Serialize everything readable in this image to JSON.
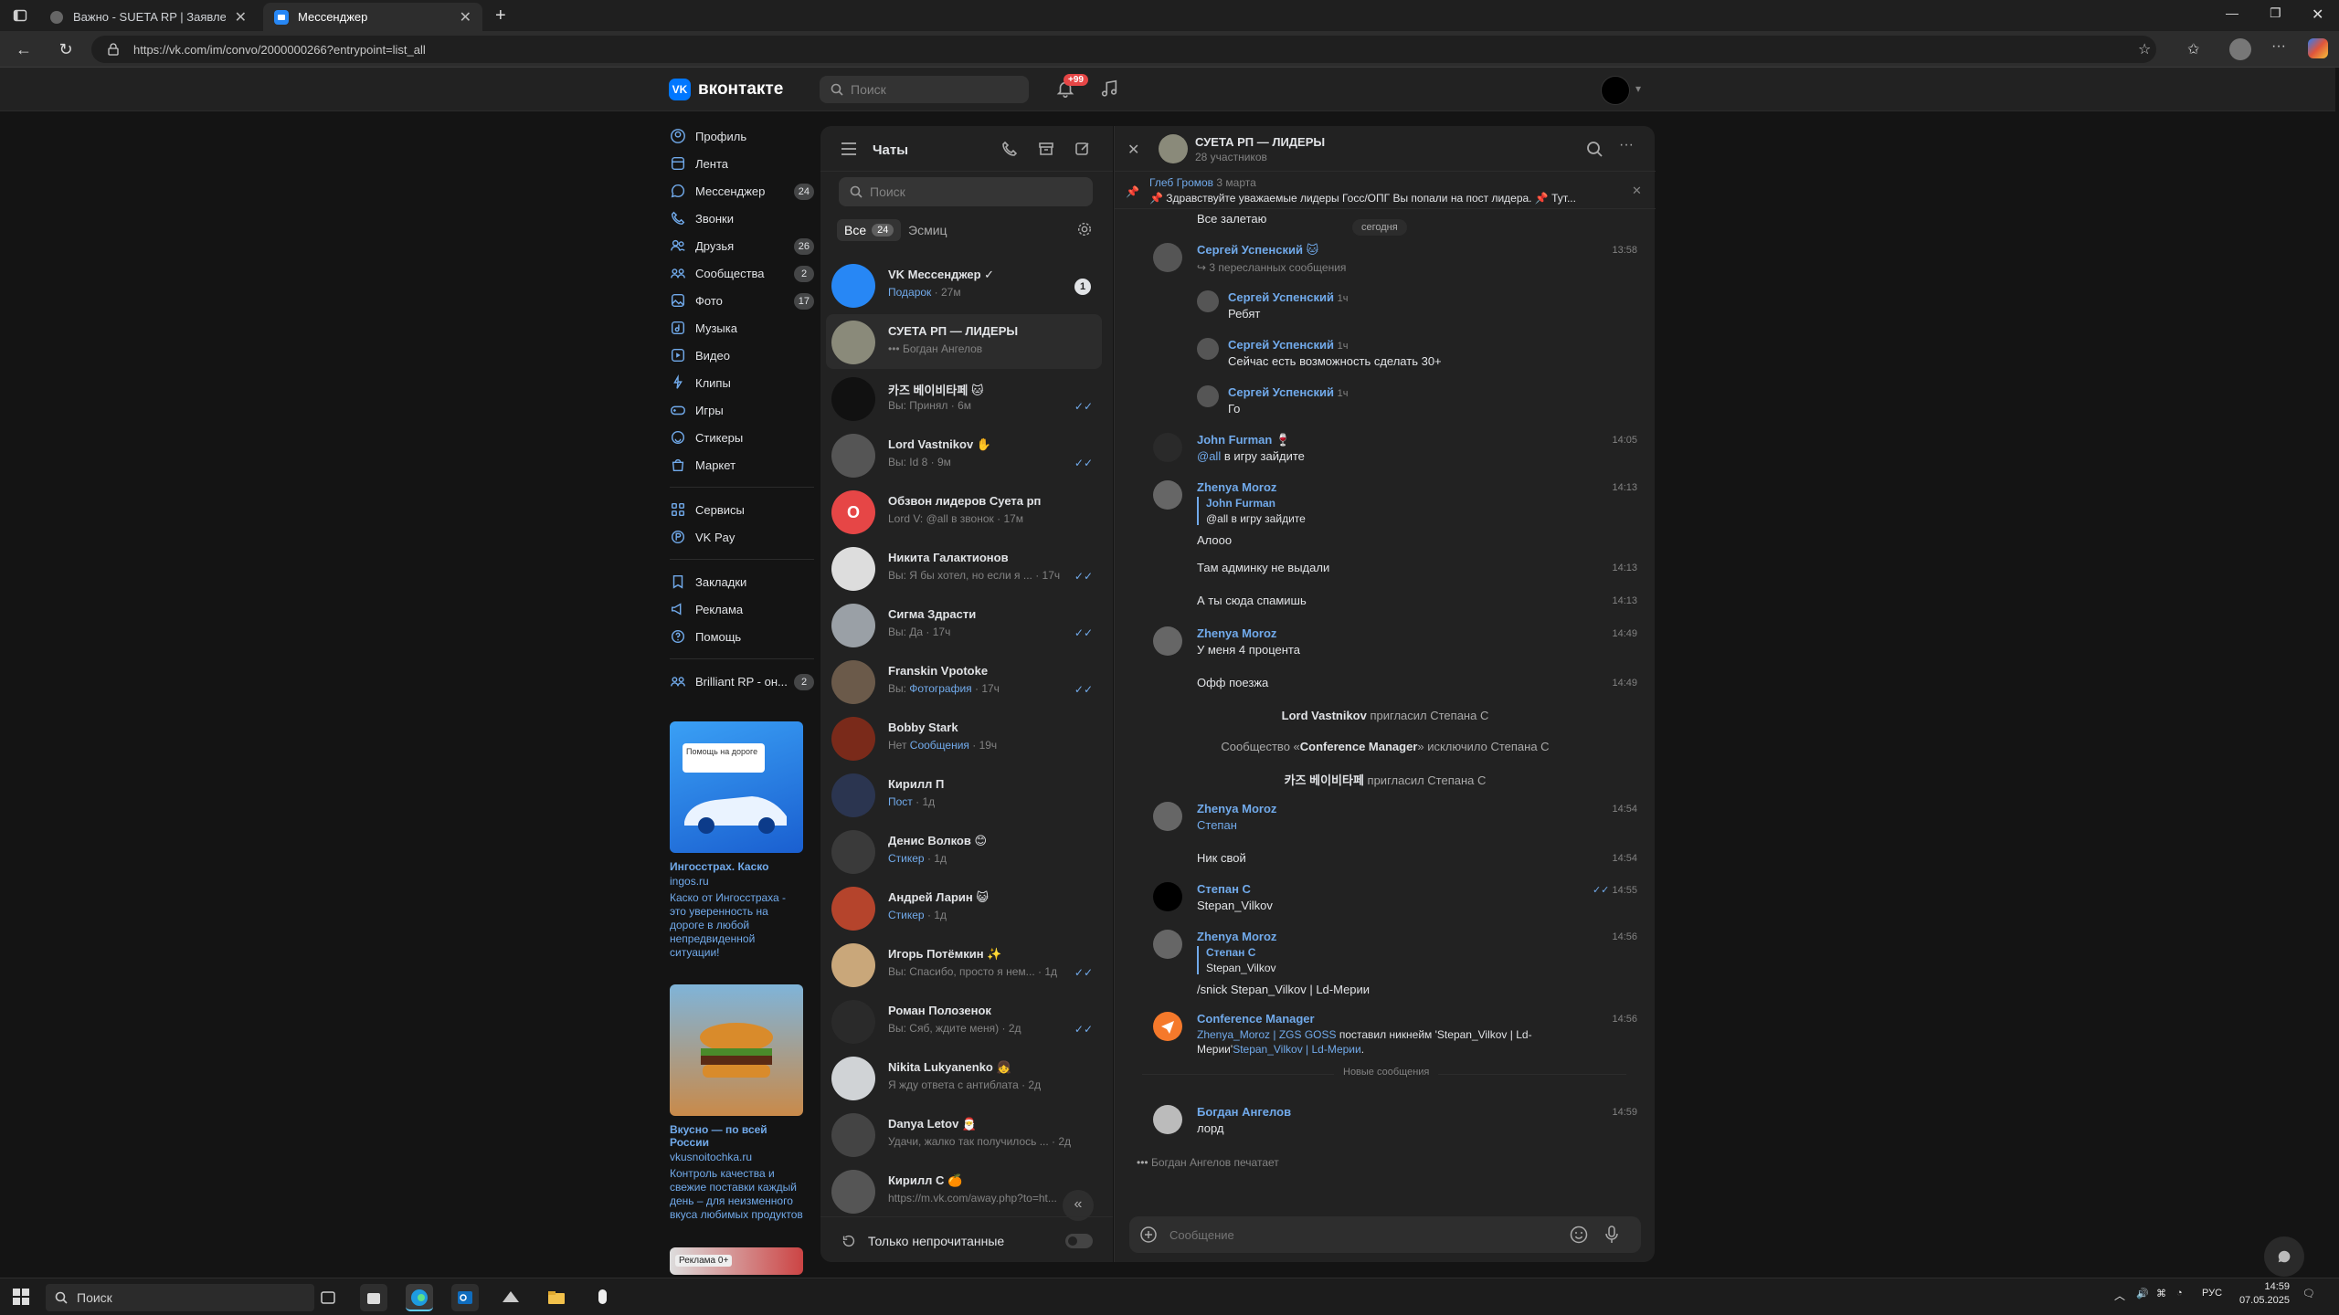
{
  "browser": {
    "tabs": [
      {
        "label": "Важно - SUETA RP | Заявление на"
      },
      {
        "label": "Мессенджер"
      }
    ],
    "url": "https://vk.com/im/convo/2000000266?entrypoint=list_all"
  },
  "header": {
    "logo_text": "вконтакте",
    "search_placeholder": "Поиск",
    "notif_badge": "+99"
  },
  "nav": {
    "items": [
      {
        "label": "Профиль",
        "count": ""
      },
      {
        "label": "Лента",
        "count": ""
      },
      {
        "label": "Мессенджер",
        "count": "24"
      },
      {
        "label": "Звонки",
        "count": ""
      },
      {
        "label": "Друзья",
        "count": "26"
      },
      {
        "label": "Сообщества",
        "count": "2"
      },
      {
        "label": "Фото",
        "count": "17"
      },
      {
        "label": "Музыка",
        "count": ""
      },
      {
        "label": "Видео",
        "count": ""
      },
      {
        "label": "Клипы",
        "count": ""
      },
      {
        "label": "Игры",
        "count": ""
      },
      {
        "label": "Стикеры",
        "count": ""
      },
      {
        "label": "Маркет",
        "count": ""
      }
    ],
    "items2": [
      {
        "label": "Сервисы"
      },
      {
        "label": "VK Pay"
      }
    ],
    "items3": [
      {
        "label": "Закладки"
      },
      {
        "label": "Реклама"
      },
      {
        "label": "Помощь"
      }
    ],
    "community": {
      "label": "Brilliant RP - он...",
      "count": "2"
    }
  },
  "ads": [
    {
      "title": "Ингосстрах. Каско",
      "domain": "ingos.ru",
      "text": "Каско от Ингосстраха - это уверенность на дороге в любой непредвиденной ситуации!",
      "img_badge": "Помощь на дороге"
    },
    {
      "title": "Вкусно — по всей России",
      "domain": "vkusnoitochka.ru",
      "text": "Контроль качества и свежие поставки каждый день – для неизменного вкуса любимых продуктов",
      "img_badge": ""
    },
    {
      "img_badge": "Реклама 0+"
    }
  ],
  "chatlist": {
    "title": "Чаты",
    "search_placeholder": "Поиск",
    "filter_all": "Все",
    "filter_all_count": "24",
    "filter_other": "Эсмиц",
    "only_unread": "Только непрочитанные",
    "chats": [
      {
        "name": "VK Мессенджер ✓",
        "preview_link": "Подарок",
        "preview": " · 27м",
        "unread": "1",
        "color": "#2787f5"
      },
      {
        "name": "СУЕТА РП — ЛИДЕРЫ",
        "preview": "••• Богдан Ангелов",
        "color": "#8a8a7a"
      },
      {
        "name": "카즈 베이비타페 🐱",
        "preview": "Вы: Принял · 6м",
        "check": "✓✓",
        "color": "#111"
      },
      {
        "name": "Lord Vastnikov ✋",
        "preview": "Вы: Id 8 · 9м",
        "check": "✓✓",
        "color": "#555"
      },
      {
        "name": "Обзвон лидеров Суета рп",
        "preview": "Lord V: @all в звонок · 17м",
        "color": "#e64646",
        "letter": "О"
      },
      {
        "name": "Никита Галактионов",
        "preview": "Вы: Я бы хотел, но если я ... · 17ч",
        "check": "✓✓",
        "color": "#ddd"
      },
      {
        "name": "Сигма Здрасти",
        "preview": "Вы: Да · 17ч",
        "check": "✓✓",
        "color": "#9aa0a6"
      },
      {
        "name": "Franskin Vpotoke",
        "preview_prefix": "Вы: ",
        "preview_link": "Фотография",
        "preview": " · 17ч",
        "check": "✓✓",
        "color": "#6b5a4a"
      },
      {
        "name": "Bobby Stark",
        "preview_prefix": "Нет ",
        "preview_link": "Сообщения",
        "preview": " · 19ч",
        "color": "#7a2a1a"
      },
      {
        "name": "Кирилл П",
        "preview_link": "Пост",
        "preview": " · 1д",
        "color": "#2b3550"
      },
      {
        "name": "Денис Волков 😊",
        "preview_link": "Стикер",
        "preview": " · 1д",
        "color": "#3a3a3a"
      },
      {
        "name": "Андрей Ларин 😺",
        "preview_link": "Стикер",
        "preview": " · 1д",
        "color": "#b5442c"
      },
      {
        "name": "Игорь Потёмкин ✨",
        "preview": "Вы: Спасибо, просто я нем... · 1д",
        "check": "✓✓",
        "color": "#c9a77a"
      },
      {
        "name": "Роман Полозенок",
        "preview": "Вы: Сяб, ждите меня) · 2д",
        "check": "✓✓",
        "color": "#2a2a2a"
      },
      {
        "name": "Nikita Lukyanenko 👧",
        "preview": "Я жду ответа с антиблата · 2д",
        "color": "#d0d3d6"
      },
      {
        "name": "Danya Letov 🎅",
        "preview": "Удачи, жалко так получилось ... · 2д",
        "color": "#444"
      },
      {
        "name": "Кирилл С 🍊",
        "preview": "https://m.vk.com/away.php?to=ht...",
        "color": "#555"
      }
    ]
  },
  "conv": {
    "title": "СУЕТА РП — ЛИДЕРЫ",
    "subtitle": "28 участников",
    "pin_author": "Глеб Громов",
    "pin_date": "3 марта",
    "pin_text": "📌 Здравствуйте уважаемые лидеры Госс/ОПГ Вы попали на пост лидера. 📌 Тут...",
    "top_text": "Все залетаю",
    "day_label": "сегодня",
    "messages": {
      "m1": {
        "author": "Сергей Успенский 🐱",
        "time": "13:58",
        "fwd": "3 пересланных сообщения"
      },
      "m1a": {
        "author": "Сергей Успенский",
        "time": "1ч",
        "text": "Ребят"
      },
      "m1b": {
        "author": "Сергей Успенский",
        "time": "1ч",
        "text": "Сейчас есть возможность сделать 30+"
      },
      "m1c": {
        "author": "Сергей Успенский",
        "time": "1ч",
        "text": "Го"
      },
      "m2": {
        "author": "John Furman 🍷",
        "time": "14:05",
        "mention": "@all",
        "text": " в игру зайдите"
      },
      "m3": {
        "author": "Zhenya Moroz",
        "time": "14:13",
        "reply_author": "John Furman",
        "reply_text": "@all в игру зайдите",
        "text": "Алооо"
      },
      "m3b": {
        "time": "14:13",
        "text": "Там админку не выдали"
      },
      "m3c": {
        "time": "14:13",
        "text": "А ты сюда спамишь"
      },
      "m4": {
        "author": "Zhenya Moroz",
        "time": "14:49",
        "text": "У меня 4 процента"
      },
      "m4b": {
        "time": "14:49",
        "text": "Офф поезжа"
      },
      "sys1": {
        "actor": "Lord Vastnikov",
        "text": " пригласил Степана С"
      },
      "sys2": {
        "prefix": "Сообщество «",
        "actor": "Conference Manager",
        "text": "» исключило Степана С"
      },
      "sys3": {
        "actor": "카즈 베이비타페",
        "text": " пригласил Степана С"
      },
      "m5": {
        "author": "Zhenya Moroz",
        "time": "14:54",
        "link": "Степан"
      },
      "m5b": {
        "time": "14:54",
        "text": "Ник свой"
      },
      "m6": {
        "author": "Степан С",
        "time": "14:55",
        "text": "Stepan_Vilkov",
        "check": "✓✓"
      },
      "m7": {
        "author": "Zhenya Moroz",
        "time": "14:56",
        "reply_author": "Степан С",
        "reply_text": "Stepan_Vilkov",
        "text": "/snick Stepan_Vilkov | Ld-Мерии"
      },
      "m8": {
        "author": "Conference Manager",
        "time": "14:56",
        "link1": "Zhenya_Moroz | ZGS GOSS",
        "text1": " поставил никнейм 'Stepan_Vilkov | Ld-",
        "text2": "Мерии'",
        "link2": "Stepan_Vilkov | Ld-Мерии",
        "text3": "."
      },
      "new_label": "Новые сообщения",
      "m9": {
        "author": "Богдан Ангелов",
        "time": "14:59",
        "text": "лорд"
      }
    },
    "typing": "Богдан Ангелов печатает",
    "composer_placeholder": "Сообщение"
  },
  "taskbar": {
    "search_placeholder": "Поиск",
    "lang": "РУС",
    "time": "14:59",
    "date": "07.05.2025"
  }
}
